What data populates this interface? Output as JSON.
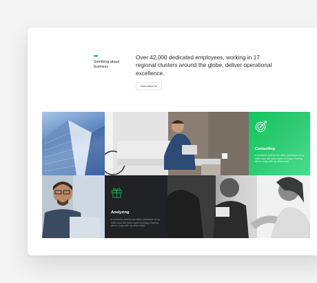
{
  "about": {
    "label": "Somthing about business",
    "headline": "Over 42,000 dedicated employees, working in 17 regional clusters around the globe, deliver operational excellence.",
    "button_label": "More About Us"
  },
  "features": [
    {
      "title": "Consulting",
      "body": "A wonderful serenity has taken possession of my entire soul, like these sweet mornings of spring which I enjoy with my whole heart.",
      "icon": "target-icon"
    },
    {
      "title": "Analyzing",
      "body": "A wonderful serenity has taken possession of my entire soul, like these sweet mornings of spring which I enjoy with my whole heart.",
      "icon": "gift-icon"
    }
  ],
  "colors": {
    "accent": "#1bb35a",
    "consulting_start": "#15c45e",
    "consulting_end": "#49dc90",
    "analyzing_bg": "#202225"
  }
}
